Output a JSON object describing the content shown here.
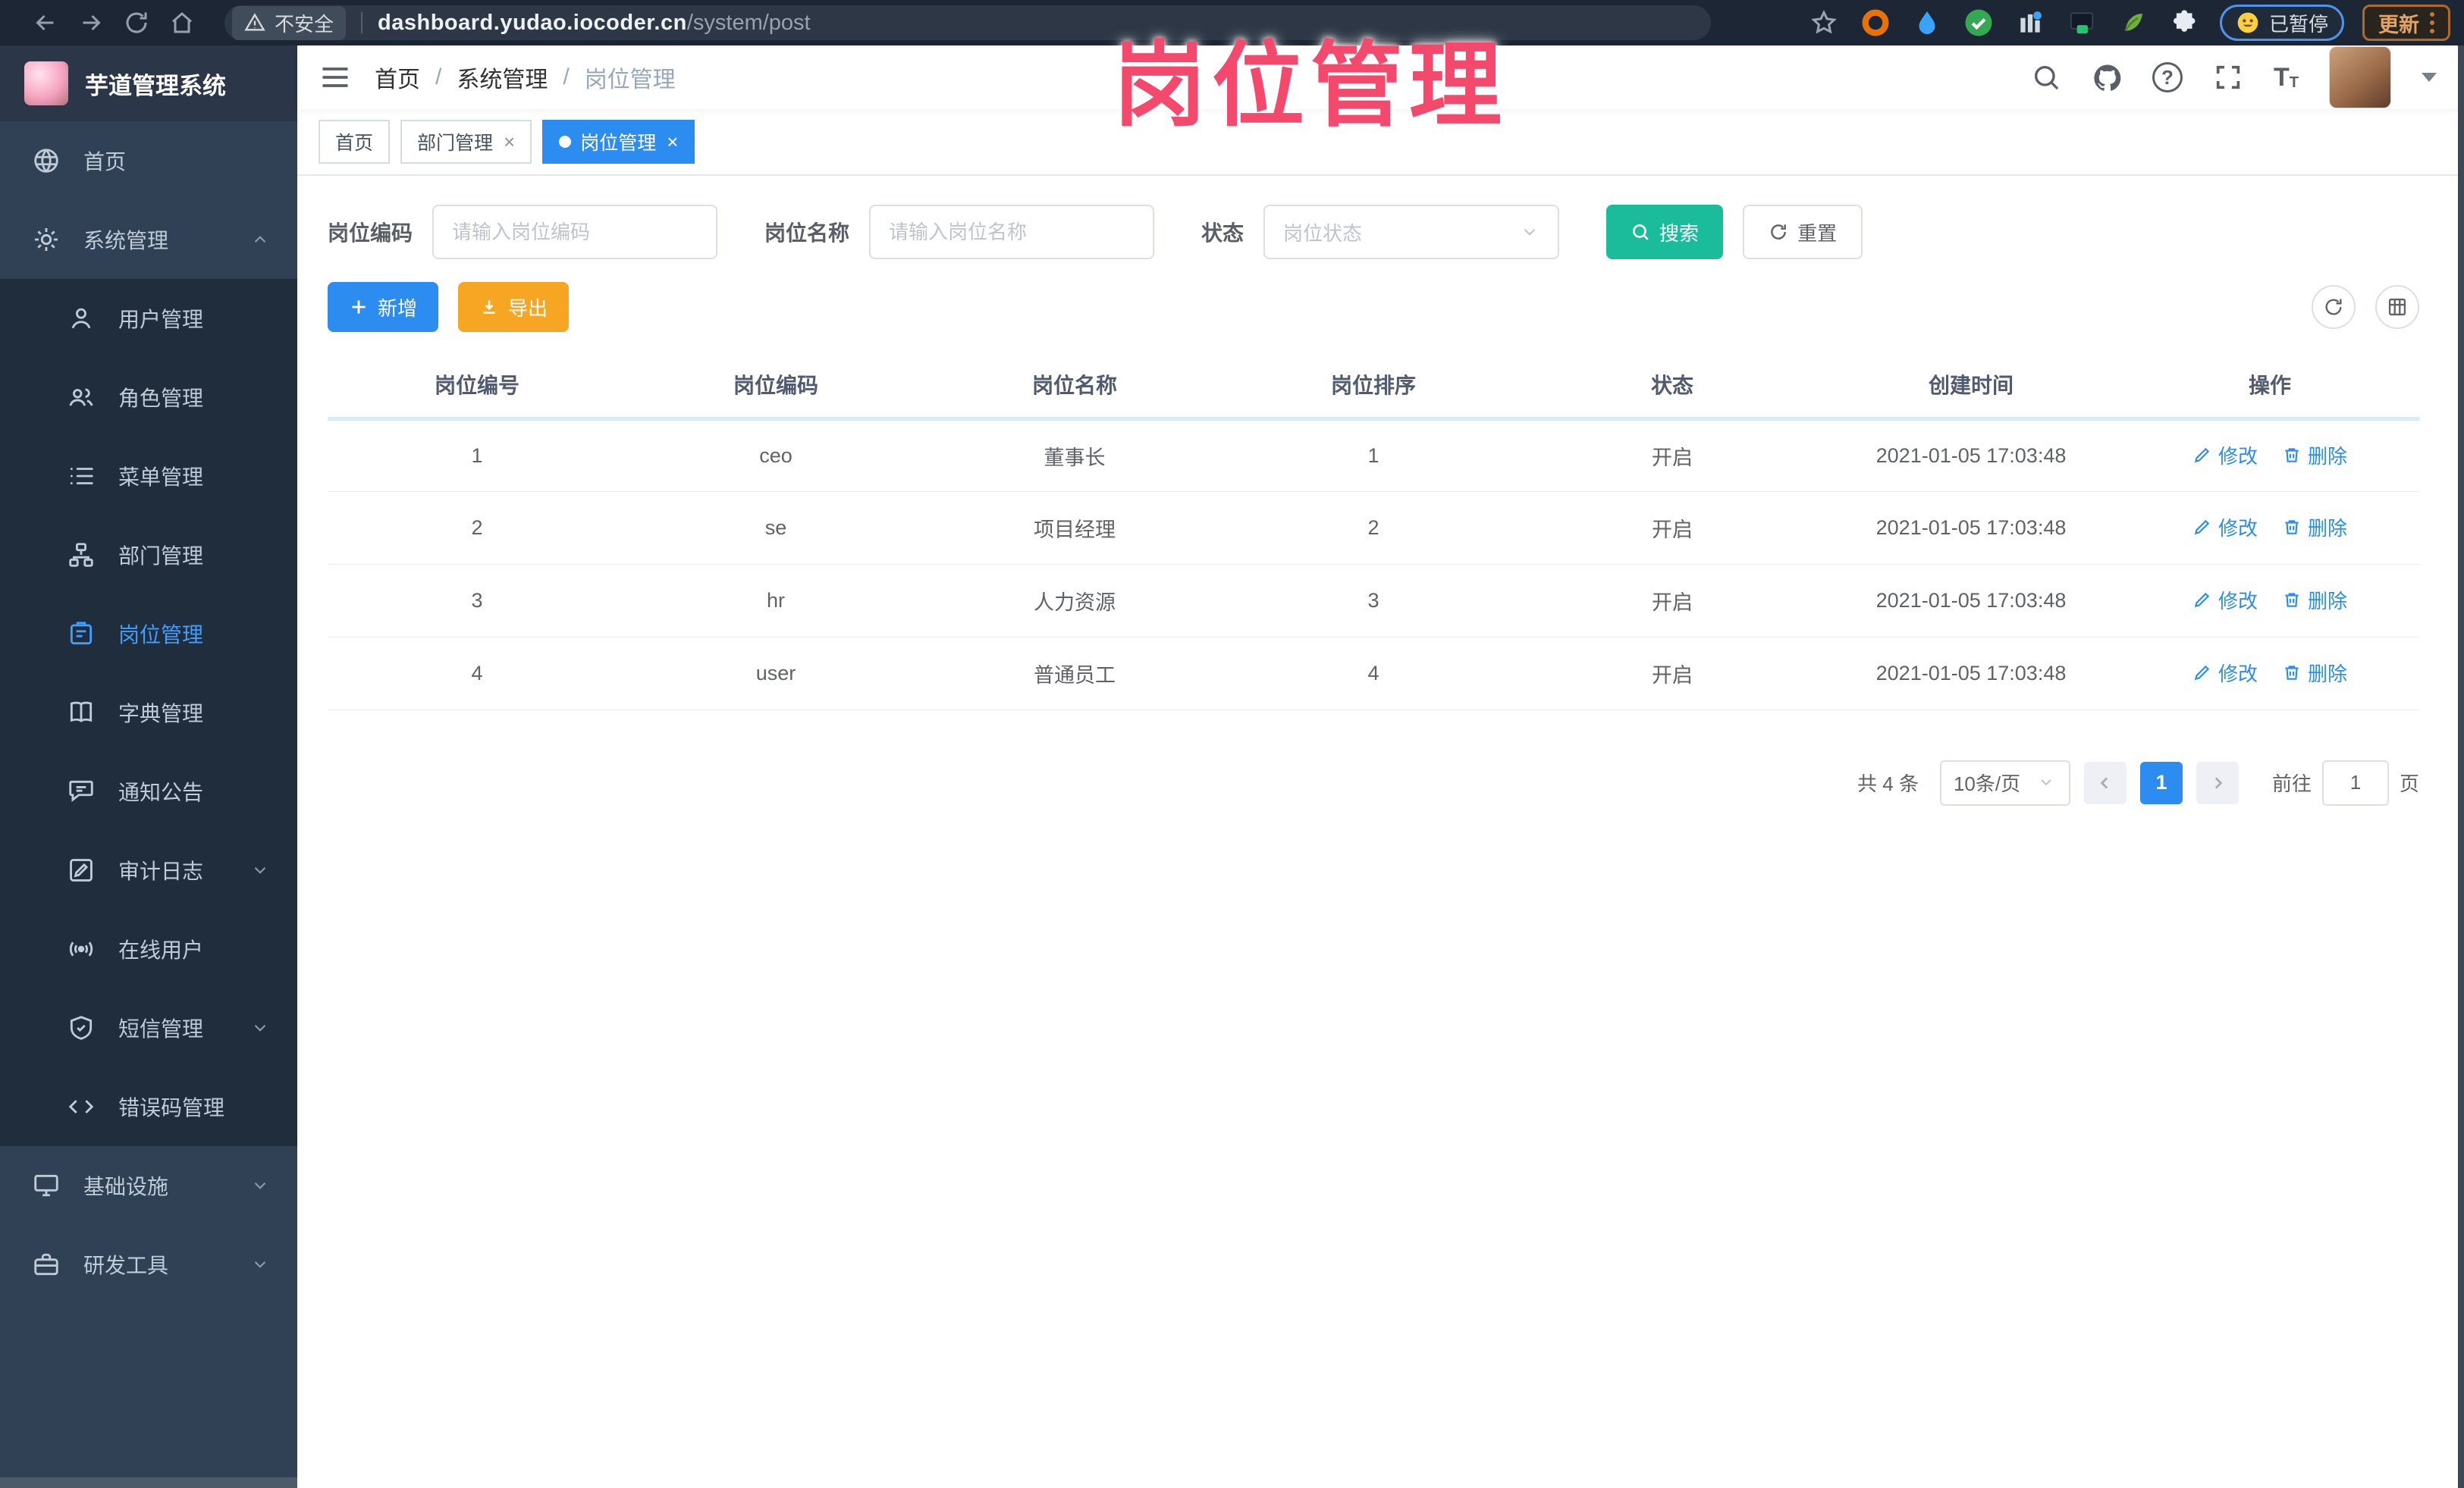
{
  "browser": {
    "security_label": "不安全",
    "url_host": "dashboard.yudao.iocoder.cn",
    "url_path": "/system/post",
    "paused_badge": "已暂停",
    "update_button": "更新"
  },
  "overlay_title": "岗位管理",
  "sidebar": {
    "logo_title": "芋道管理系统",
    "items": [
      {
        "label": "首页"
      },
      {
        "label": "系统管理"
      },
      {
        "label": "用户管理"
      },
      {
        "label": "角色管理"
      },
      {
        "label": "菜单管理"
      },
      {
        "label": "部门管理"
      },
      {
        "label": "岗位管理"
      },
      {
        "label": "字典管理"
      },
      {
        "label": "通知公告"
      },
      {
        "label": "审计日志"
      },
      {
        "label": "在线用户"
      },
      {
        "label": "短信管理"
      },
      {
        "label": "错误码管理"
      },
      {
        "label": "基础设施"
      },
      {
        "label": "研发工具"
      }
    ]
  },
  "breadcrumb": {
    "items": [
      "首页",
      "系统管理",
      "岗位管理"
    ]
  },
  "tabs": [
    {
      "label": "首页"
    },
    {
      "label": "部门管理"
    },
    {
      "label": "岗位管理"
    }
  ],
  "filters": {
    "post_code_label": "岗位编码",
    "post_code_placeholder": "请输入岗位编码",
    "post_name_label": "岗位名称",
    "post_name_placeholder": "请输入岗位名称",
    "status_label": "状态",
    "status_placeholder": "岗位状态",
    "search_label": "搜索",
    "reset_label": "重置"
  },
  "toolbar": {
    "add_label": "新增",
    "export_label": "导出"
  },
  "table": {
    "headers": [
      "岗位编号",
      "岗位编码",
      "岗位名称",
      "岗位排序",
      "状态",
      "创建时间",
      "操作"
    ],
    "edit_label": "修改",
    "delete_label": "删除",
    "rows": [
      {
        "id": "1",
        "code": "ceo",
        "name": "董事长",
        "sort": "1",
        "status": "开启",
        "created": "2021-01-05 17:03:48"
      },
      {
        "id": "2",
        "code": "se",
        "name": "项目经理",
        "sort": "2",
        "status": "开启",
        "created": "2021-01-05 17:03:48"
      },
      {
        "id": "3",
        "code": "hr",
        "name": "人力资源",
        "sort": "3",
        "status": "开启",
        "created": "2021-01-05 17:03:48"
      },
      {
        "id": "4",
        "code": "user",
        "name": "普通员工",
        "sort": "4",
        "status": "开启",
        "created": "2021-01-05 17:03:48"
      }
    ]
  },
  "pagination": {
    "total_text": "共 4 条",
    "page_size": "10条/页",
    "current_page": "1",
    "goto_label": "前往",
    "goto_value": "1",
    "page_unit": "页"
  },
  "colors": {
    "primary": "#2d8cf0",
    "search_teal": "#1abc9c",
    "export_warning": "#f6a623",
    "sidebar_bg": "#304156",
    "submenu_bg": "#1f2d3d",
    "sidebar_active": "#409eff",
    "overlay_pink": "#f2496d"
  }
}
